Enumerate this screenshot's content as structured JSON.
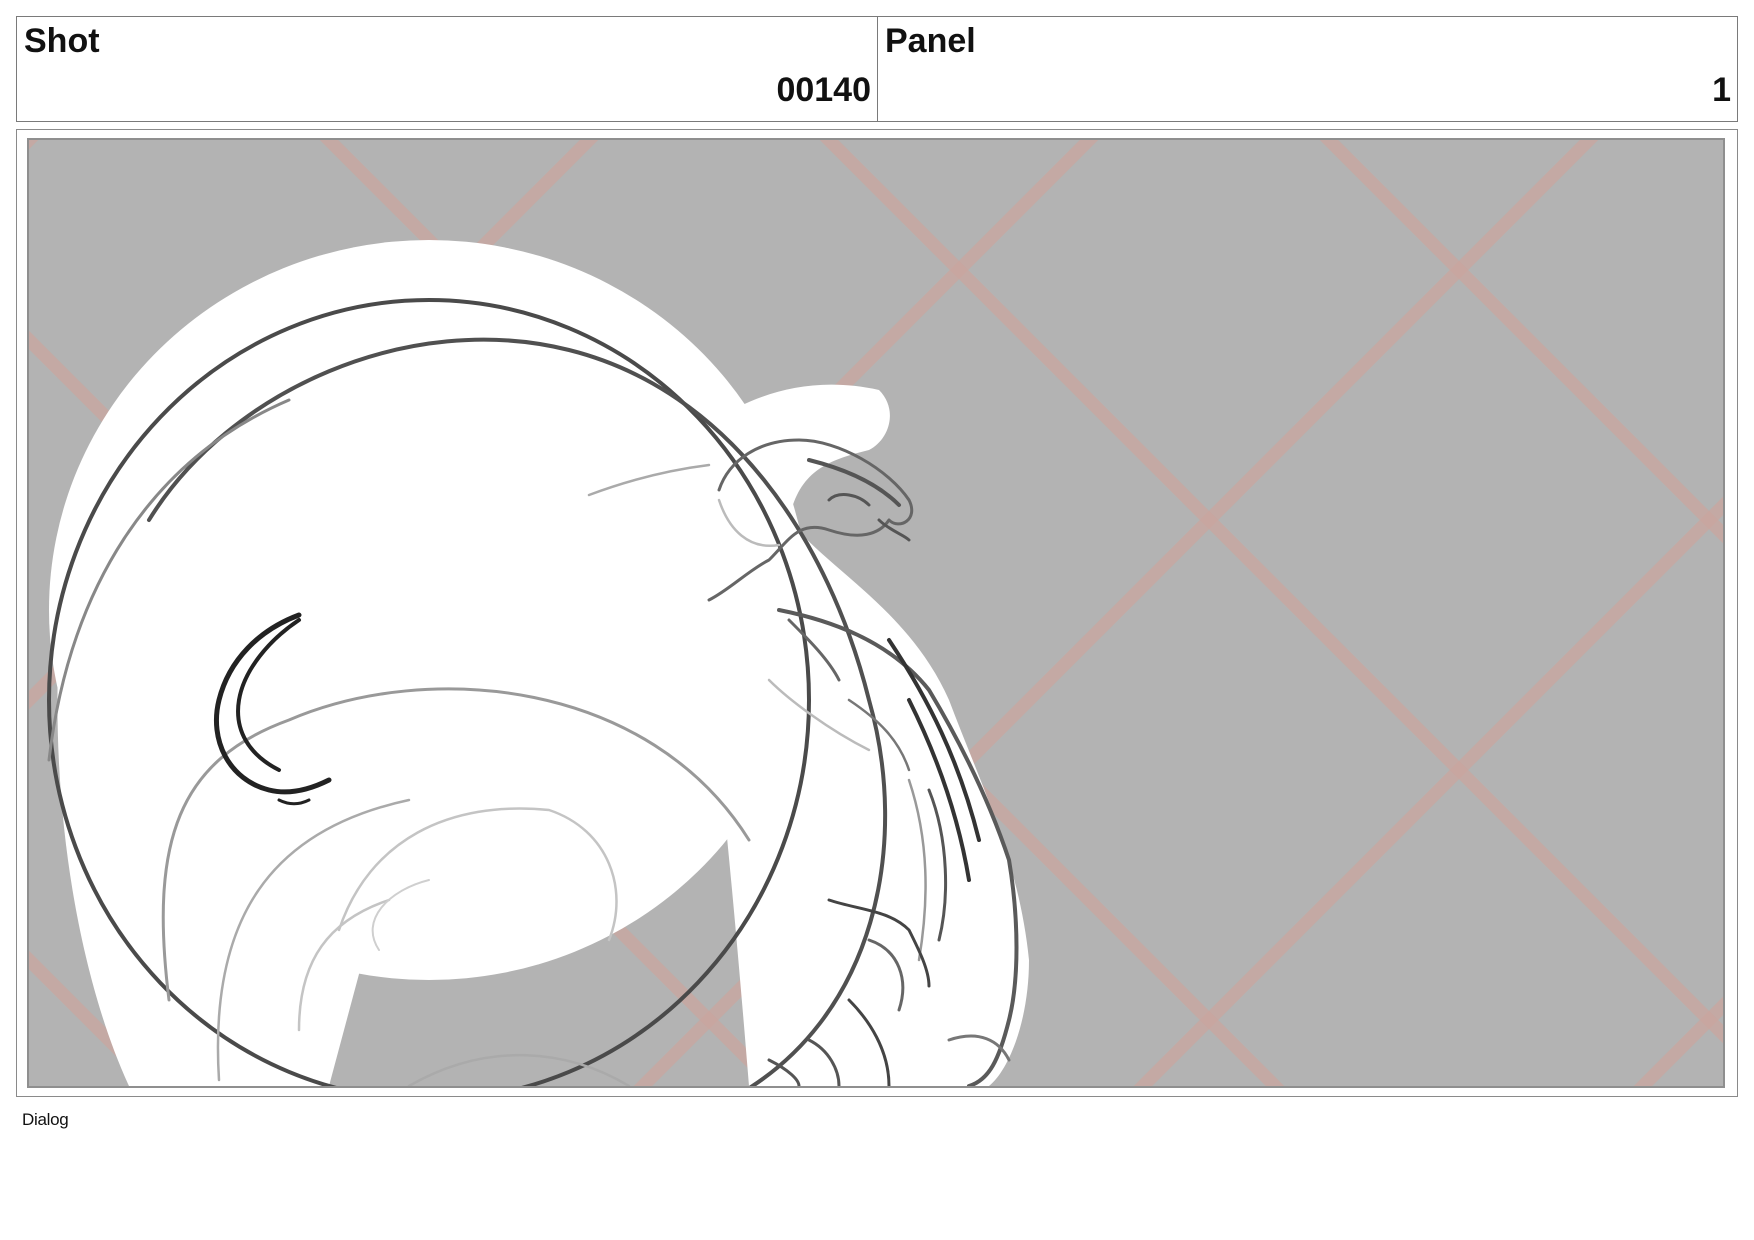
{
  "header": {
    "shot_label": "Shot",
    "shot_value": "00140",
    "panel_label": "Panel",
    "panel_value": "1"
  },
  "panel": {
    "background_color": "#b3b3b3",
    "grid_color": "#c9a59f",
    "sketch_fill": "#ffffff",
    "sketch_stroke": "#4a4a4a"
  },
  "dialog": {
    "label": "Dialog"
  }
}
